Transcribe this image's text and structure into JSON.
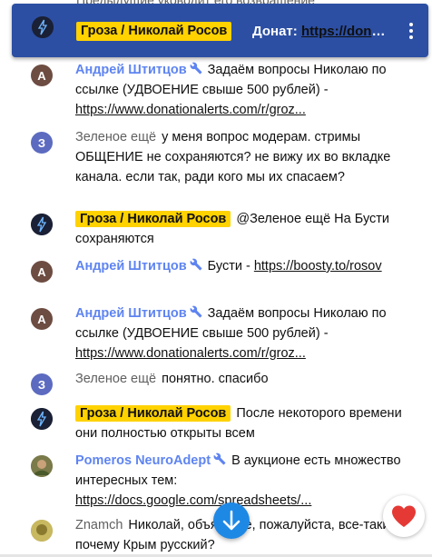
{
  "background_text": "Предыдущие уководит его возвращение",
  "pinned": {
    "author": "Гроза / Николай Росов",
    "text_label": "Донат: ",
    "text_link": "https://donationalerts.com/r/grozarosov",
    "menu_icon": "more-vert-icon",
    "colors": {
      "background": "#2c4fa3",
      "owner_badge": "#ffd200"
    }
  },
  "messages": [
    {
      "author": "Андрей Штитцов",
      "avatar_letter": "А",
      "badge": "wrench-icon",
      "text": "Задаём вопросы Николаю по ссылке (УДВОЕНИЕ свыше 500 рублей) - ",
      "link": "https://www.donationalerts.com/r/groz..."
    },
    {
      "author": "Зеленое ещё",
      "avatar_letter": "З",
      "text": "у меня вопрос модерам. стримы ОБЩЕНИЕ не сохраняются? не вижу их во вкладке канала. если так, ради кого мы их спасаем?"
    },
    {
      "author": "Гроза / Николай Росов",
      "text": "@Зеленое ещё На Бусти сохраняются"
    },
    {
      "author": "Андрей Штитцов",
      "avatar_letter": "А",
      "badge": "wrench-icon",
      "text": "Бусти - ",
      "link": "https://boosty.to/rosov"
    },
    {
      "author": "Андрей Штитцов",
      "avatar_letter": "А",
      "badge": "wrench-icon",
      "text": "Задаём вопросы Николаю по ссылке (УДВОЕНИЕ свыше 500 рублей) - ",
      "link": "https://www.donationalerts.com/r/groz..."
    },
    {
      "author": "Зеленое ещё",
      "avatar_letter": "З",
      "text": "понятно. спасибо"
    },
    {
      "author": "Гроза / Николай Росов",
      "text": "После некоторого времени они полностью открыты всем"
    },
    {
      "author": "Pomeros NeuroAdept",
      "badge": "wrench-icon",
      "text": "В аукционе есть множество интересных тем: ",
      "link": "https://docs.google.com/spreadsheets/..."
    },
    {
      "author": "Znamch",
      "text": "Николай, объясните, пожалуйста, все-таки почему Крым русский?"
    }
  ],
  "buttons": {
    "scroll_down_icon": "arrow-down-icon",
    "reaction_icon": "heart-icon",
    "scroll_color": "#1e88e5",
    "heart_color": "#e53935"
  }
}
